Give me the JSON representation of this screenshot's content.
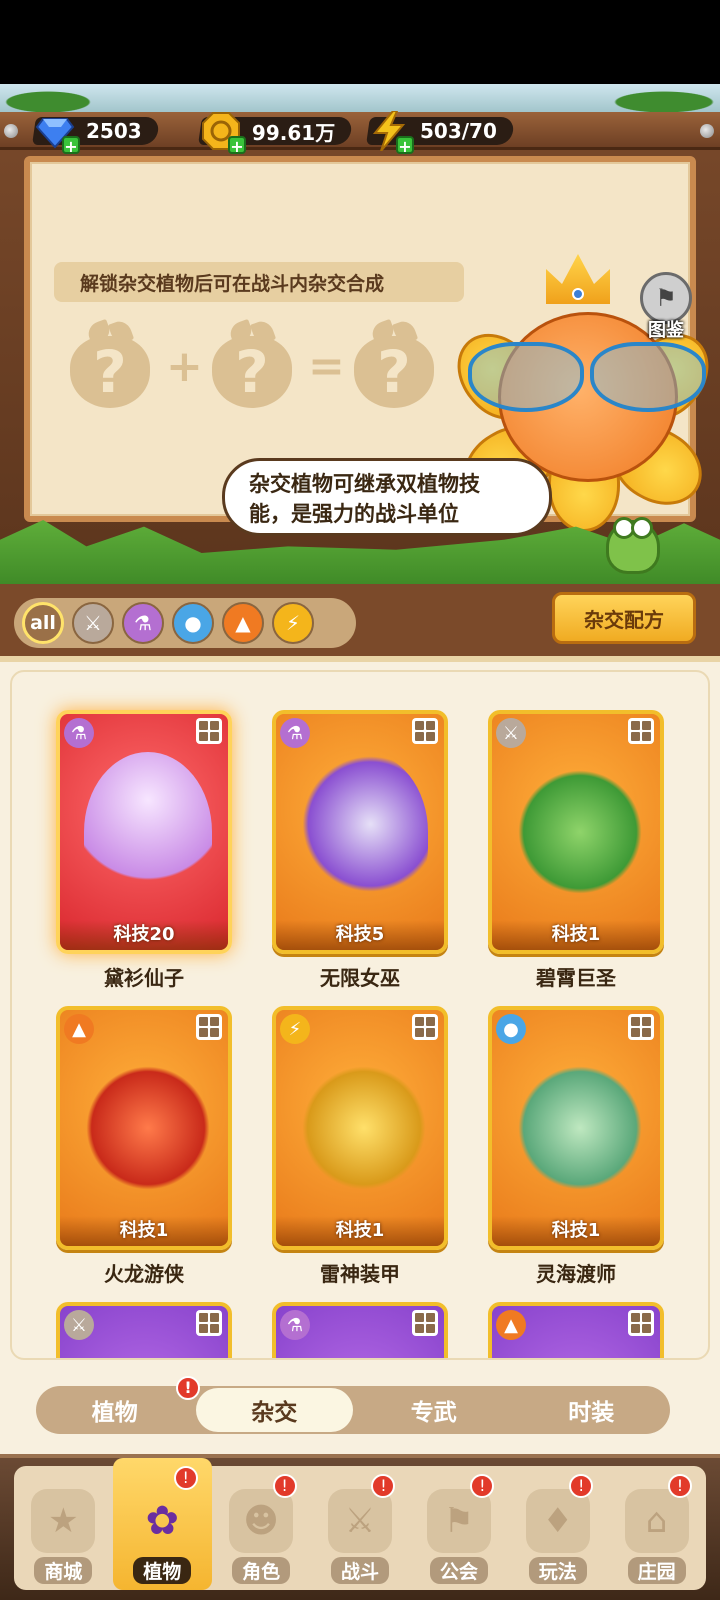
{
  "currencies": [
    {
      "name": "diamond",
      "icon": "diamond-icon",
      "value": "2503",
      "color": "#3d7ff0"
    },
    {
      "name": "gold",
      "icon": "gold-coin-icon",
      "value": "99.61万",
      "color": "#f4b51b"
    },
    {
      "name": "energy",
      "icon": "lightning-icon",
      "value": "503/70",
      "color": "#f4c21b"
    }
  ],
  "hero": {
    "unlock_banner": "解锁杂交植物后可在战斗内杂交合成",
    "formula": {
      "q": "?",
      "plus": "+",
      "equals": "="
    },
    "atlas_label": "图鉴",
    "bubble_line1": "杂交植物可继承双植物技",
    "bubble_line2": "能，是强力的战斗单位"
  },
  "filters": {
    "all_label": "all",
    "chips": [
      "sword-icon",
      "potion-icon",
      "water-drop-icon",
      "fire-icon",
      "lightning-icon"
    ],
    "recipe_button": "杂交配方"
  },
  "cards": [
    {
      "name": "黛衫仙子",
      "tech": "科技20",
      "element": "potion-icon",
      "style": "red"
    },
    {
      "name": "无限女巫",
      "tech": "科技5",
      "element": "potion-icon",
      "style": "orange"
    },
    {
      "name": "碧霄巨圣",
      "tech": "科技1",
      "element": "sword-icon",
      "style": "orange"
    },
    {
      "name": "火龙游侠",
      "tech": "科技1",
      "element": "fire-icon",
      "style": "orange"
    },
    {
      "name": "雷神装甲",
      "tech": "科技1",
      "element": "lightning-icon",
      "style": "orange"
    },
    {
      "name": "灵海渡师",
      "tech": "科技1",
      "element": "water-drop-icon",
      "style": "orange"
    },
    {
      "name": "",
      "tech": "",
      "element": "sword-icon",
      "style": "purple"
    },
    {
      "name": "",
      "tech": "",
      "element": "potion-icon",
      "style": "purple"
    },
    {
      "name": "",
      "tech": "",
      "element": "fire-icon",
      "style": "purple"
    }
  ],
  "subtabs": [
    {
      "label": "植物",
      "active": false,
      "badge": "!"
    },
    {
      "label": "杂交",
      "active": true
    },
    {
      "label": "专武",
      "active": false
    },
    {
      "label": "时装",
      "active": false
    }
  ],
  "nav": [
    {
      "label": "商城",
      "icon": "shop-icon",
      "active": false,
      "badge": ""
    },
    {
      "label": "植物",
      "icon": "plant-icon",
      "active": true,
      "badge": "!"
    },
    {
      "label": "角色",
      "icon": "character-icon",
      "active": false,
      "badge": "!"
    },
    {
      "label": "战斗",
      "icon": "battle-icon",
      "active": false,
      "badge": "!"
    },
    {
      "label": "公会",
      "icon": "guild-icon",
      "active": false,
      "badge": "!"
    },
    {
      "label": "玩法",
      "icon": "gameplay-icon",
      "active": false,
      "badge": "!"
    },
    {
      "label": "庄园",
      "icon": "manor-icon",
      "active": false,
      "badge": "!"
    }
  ]
}
